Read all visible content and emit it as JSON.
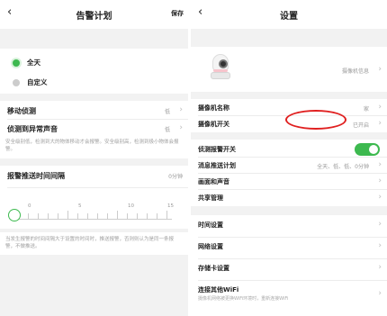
{
  "left": {
    "title": "告警计划",
    "back_icon": "‹",
    "save_label": "保存",
    "options": [
      {
        "label": "全天",
        "selected": true
      },
      {
        "label": "自定义",
        "selected": false
      }
    ],
    "motion": {
      "label": "移动侦测",
      "value": "低"
    },
    "sound": {
      "label": "侦测到异常声音",
      "value": "低"
    },
    "sens_desc": "安全级别低，检测到大的物体移动才会报警。安全级别高，检测到极小物体会报警。",
    "interval": {
      "label": "报警推送时间间隔",
      "value": "0分钟"
    },
    "scale_labels": [
      "0",
      "5",
      "10",
      "15"
    ],
    "slider_value": 0,
    "interval_desc": "当发生报警的时间间隔大于设置的时间时，推送报警，否则则认为是同一条报警，不做推送。"
  },
  "right": {
    "title": "设置",
    "back_icon": "‹",
    "camera_info": "摄像机信息",
    "rows": [
      {
        "label": "摄像机名称",
        "value": "家"
      },
      {
        "label": "摄像机开关",
        "value": "已开启"
      },
      {
        "label": "侦测报警开关",
        "toggle": true
      },
      {
        "label": "消息推送计划",
        "value": "全天、低、低、0分钟"
      },
      {
        "label": "画面和声音",
        "value": ""
      },
      {
        "label": "共享管理",
        "value": ""
      },
      {
        "label": "时间设置",
        "value": ""
      },
      {
        "label": "网络设置",
        "value": ""
      },
      {
        "label": "存储卡设置",
        "value": ""
      },
      {
        "label": "连接其他WiFi",
        "value": "",
        "sub": "摄像机网络被更换WiFi环境时，重新连接WiFi"
      }
    ]
  },
  "colors": {
    "accent": "#3db94f",
    "highlight": "#e02020",
    "section_gap": "#f2f2f2"
  }
}
